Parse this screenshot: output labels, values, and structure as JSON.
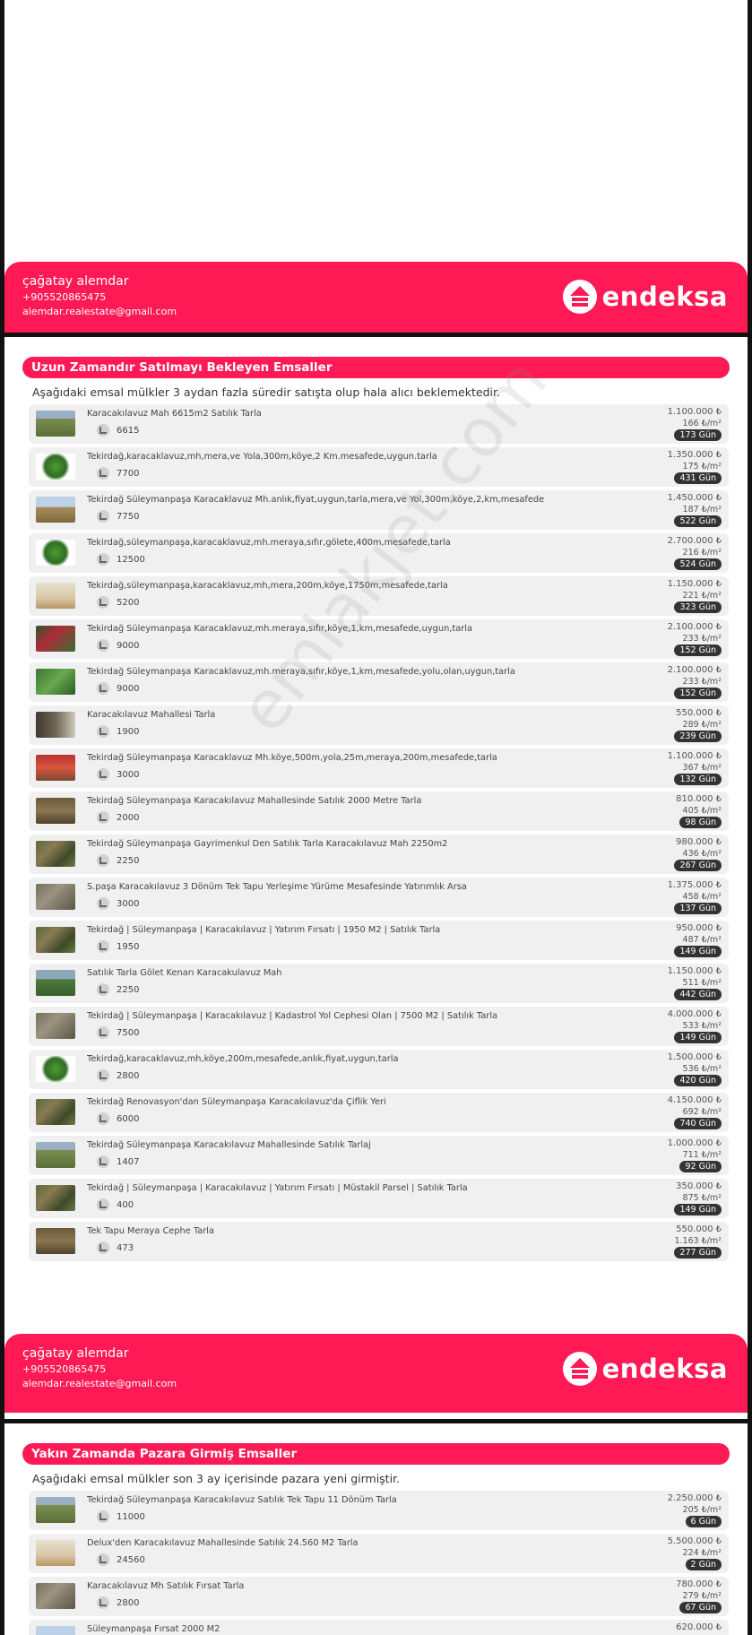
{
  "agent": {
    "name": "çağatay alemdar",
    "phone": "+905520865475",
    "email": "alemdar.realestate@gmail.com"
  },
  "brand": {
    "name": "endeksa",
    "color": "#ff1a55"
  },
  "watermark": "emlakjet.com",
  "section1": {
    "title": "Uzun Zamandır Satılmayı Bekleyen Emsaller",
    "description": "Aşağıdaki emsal mülkler 3 aydan fazla süredir satışta olup hala alıcı beklemektedir.",
    "listings": [
      {
        "title": "Karacakılavuz Mah 6615m2 Satılık Tarla",
        "area": "6615",
        "price": "1.100.000 ₺",
        "ppm": "166 ₺/m²",
        "days": "173 Gün",
        "thumb": "t-field"
      },
      {
        "title": "Tekirdağ,karacaklavuz,mh,mera,ve Yola,300m,köye,2 Km.mesafede,uygun.tarla",
        "area": "7700",
        "price": "1.350.000 ₺",
        "ppm": "175 ₺/m²",
        "days": "431 Gün",
        "thumb": "t-green"
      },
      {
        "title": "Tekirdağ Süleymanpaşa Karacaklavuz Mh.anlık,fiyat,uygun,tarla,mera,ve Yol,300m,köye,2,km,mesafede",
        "area": "7750",
        "price": "1.450.000 ₺",
        "ppm": "187 ₺/m²",
        "days": "522 Gün",
        "thumb": "t-plain"
      },
      {
        "title": "Tekirdağ,süleymanpaşa,karacaklavuz,mh.meraya,sıfır,gölete,400m,mesafede,tarla",
        "area": "12500",
        "price": "2.700.000 ₺",
        "ppm": "216 ₺/m²",
        "days": "524 Gün",
        "thumb": "t-green"
      },
      {
        "title": "Tekirdağ,süleymanpaşa,karacaklavuz,mh,mera,200m,köye,1750m,mesafede,tarla",
        "area": "5200",
        "price": "1.150.000 ₺",
        "ppm": "221 ₺/m²",
        "days": "323 Gün",
        "thumb": "t-sand"
      },
      {
        "title": "Tekirdağ Süleymanpaşa Karacaklavuz,mh.meraya,sıfır,köye,1,km,mesafede,uygun,tarla",
        "area": "9000",
        "price": "2.100.000 ₺",
        "ppm": "233 ₺/m²",
        "days": "152 Gün",
        "thumb": "t-red"
      },
      {
        "title": "Tekirdağ Süleymanpaşa Karacaklavuz,mh.meraya,sıfır,köye,1,km,mesafede,yolu,olan,uygun,tarla",
        "area": "9000",
        "price": "2.100.000 ₺",
        "ppm": "233 ₺/m²",
        "days": "152 Gün",
        "thumb": "t-leaf"
      },
      {
        "title": "Karacakılavuz Mahallesi Tarla",
        "area": "1900",
        "price": "550.000 ₺",
        "ppm": "289 ₺/m²",
        "days": "239 Gün",
        "thumb": "t-dark"
      },
      {
        "title": "Tekirdağ Süleymanpaşa Karacaklavuz Mh.köye,500m,yola,25m,meraya,200m,mesafede,tarla",
        "area": "3000",
        "price": "1.100.000 ₺",
        "ppm": "367 ₺/m²",
        "days": "132 Gün",
        "thumb": "t-sign"
      },
      {
        "title": "Tekirdağ Süleymanpaşa Karacakılavuz Mahallesinde Satılık 2000 Metre Tarla",
        "area": "2000",
        "price": "810.000 ₺",
        "ppm": "405 ₺/m²",
        "days": "98 Gün",
        "thumb": "t-brown"
      },
      {
        "title": "Tekirdağ Süleymanpaşa Gayrimenkul Den Satılık Tarla Karacakılavuz Mah 2250m2",
        "area": "2250",
        "price": "980.000 ₺",
        "ppm": "436 ₺/m²",
        "days": "267 Gün",
        "thumb": "t-aerial"
      },
      {
        "title": "S.paşa Karacakılavuz 3 Dönüm Tek Tapu Yerleşime Yürüme Mesafesinde Yatırımlık Arsa",
        "area": "3000",
        "price": "1.375.000 ₺",
        "ppm": "458 ₺/m²",
        "days": "137 Gün",
        "thumb": "t-city"
      },
      {
        "title": "Tekirdağ | Süleymanpaşa | Karacakılavuz | Yatırım Fırsatı | 1950 M2 | Satılık Tarla",
        "area": "1950",
        "price": "950.000 ₺",
        "ppm": "487 ₺/m²",
        "days": "149 Gün",
        "thumb": "t-aerial"
      },
      {
        "title": "Satılık Tarla Gölet Kenarı Karacakulavuz Mah",
        "area": "2250",
        "price": "1.150.000 ₺",
        "ppm": "511 ₺/m²",
        "days": "442 Gün",
        "thumb": "t-lake"
      },
      {
        "title": "Tekirdağ | Süleymanpaşa | Karacakılavuz | Kadastrol Yol Cephesi Olan | 7500 M2 | Satılık Tarla",
        "area": "7500",
        "price": "4.000.000 ₺",
        "ppm": "533 ₺/m²",
        "days": "149 Gün",
        "thumb": "t-city"
      },
      {
        "title": "Tekirdağ,karacaklavuz,mh,köye,200m,mesafede,anlık,fiyat,uygun,tarla",
        "area": "2800",
        "price": "1.500.000 ₺",
        "ppm": "536 ₺/m²",
        "days": "420 Gün",
        "thumb": "t-green"
      },
      {
        "title": "Tekirdağ Renovasyon'dan Süleymanpaşa Karacakılavuz'da Çiflik Yeri",
        "area": "6000",
        "price": "4.150.000 ₺",
        "ppm": "692 ₺/m²",
        "days": "740 Gün",
        "thumb": "t-aerial"
      },
      {
        "title": "Tekirdağ Süleymanpaşa Karacakılavuz Mahallesinde Satılık Tarlaj",
        "area": "1407",
        "price": "1.000.000 ₺",
        "ppm": "711 ₺/m²",
        "days": "92 Gün",
        "thumb": "t-field"
      },
      {
        "title": "Tekirdağ | Süleymanpaşa | Karacakılavuz | Yatırım Fırsatı | Müstakil Parsel | Satılık Tarla",
        "area": "400",
        "price": "350.000 ₺",
        "ppm": "875 ₺/m²",
        "days": "149 Gün",
        "thumb": "t-aerial"
      },
      {
        "title": "Tek Tapu Meraya Cephe Tarla",
        "area": "473",
        "price": "550.000 ₺",
        "ppm": "1.163 ₺/m²",
        "days": "277 Gün",
        "thumb": "t-brown"
      }
    ]
  },
  "section2": {
    "title": "Yakın Zamanda Pazara Girmiş Emsaller",
    "description": "Aşağıdaki emsal mülkler son 3 ay içerisinde pazara yeni girmiştir.",
    "listings": [
      {
        "title": "Tekirdağ Süleymanpaşa Karacakılavuz Satılık Tek Tapu 11 Dönüm Tarla",
        "area": "11000",
        "price": "2.250.000 ₺",
        "ppm": "205 ₺/m²",
        "days": "6 Gün",
        "thumb": "t-field"
      },
      {
        "title": "Delux'den Karacakılavuz Mahallesinde Satılık 24.560 M2 Tarla",
        "area": "24560",
        "price": "5.500.000 ₺",
        "ppm": "224 ₺/m²",
        "days": "2 Gün",
        "thumb": "t-sand"
      },
      {
        "title": "Karacakılavuz Mh Satılık Fırsat Tarla",
        "area": "2800",
        "price": "780.000 ₺",
        "ppm": "279 ₺/m²",
        "days": "67 Gün",
        "thumb": "t-city"
      },
      {
        "title": "Süleymanpaşa Fırsat 2000 M2",
        "area": "2000",
        "price": "620.000 ₺",
        "ppm": "",
        "days": "",
        "thumb": "t-plain"
      }
    ]
  }
}
